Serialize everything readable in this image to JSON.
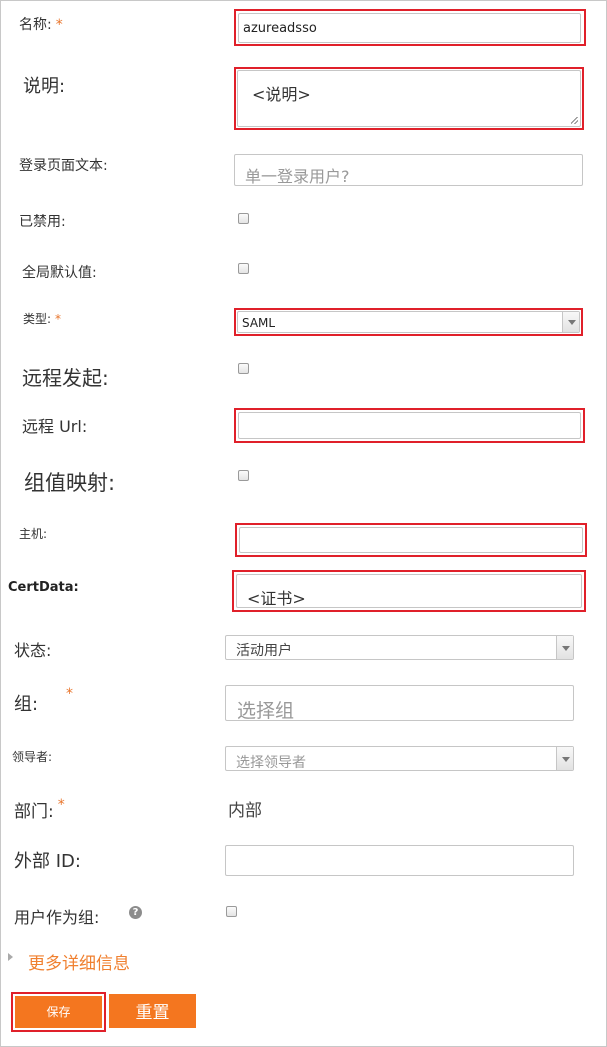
{
  "form": {
    "name": {
      "label": "名称:",
      "required": "*",
      "value": "azureadsso"
    },
    "description": {
      "label": "说明:",
      "value": "<说明>"
    },
    "login_text": {
      "label": "登录页面文本:",
      "placeholder": "单一登录用户?"
    },
    "disabled": {
      "label": "已禁用:",
      "checked": false
    },
    "global_default": {
      "label": "全局默认值:",
      "checked": false
    },
    "type": {
      "label": "类型:",
      "required": "*",
      "value": "SAML"
    },
    "remote_initiate": {
      "label": "远程发起:",
      "checked": false
    },
    "remote_url": {
      "label": "远程 Url:",
      "value": ""
    },
    "group_mapping": {
      "label": "组值映射:",
      "checked": false
    },
    "host": {
      "label": "主机:",
      "value": ""
    },
    "cert_data": {
      "label": "CertData:",
      "value": "<证书>"
    },
    "status": {
      "label": "状态:",
      "value": "活动用户"
    },
    "group": {
      "label": "组:",
      "required": "*",
      "placeholder": "选择组"
    },
    "leader": {
      "label": "领导者:",
      "placeholder": "选择领导者"
    },
    "department": {
      "label": "部门:",
      "required": "*",
      "value": "内部"
    },
    "external_id": {
      "label": "外部 ID:",
      "value": ""
    },
    "user_as_group": {
      "label": "用户作为组:",
      "help": "?",
      "checked": false
    },
    "more_details": {
      "label": "更多详细信息"
    }
  },
  "buttons": {
    "save": "保存",
    "reset": "重置"
  },
  "colors": {
    "accent": "#f4761f",
    "highlight": "#e0202a",
    "required": "#e8742a"
  }
}
